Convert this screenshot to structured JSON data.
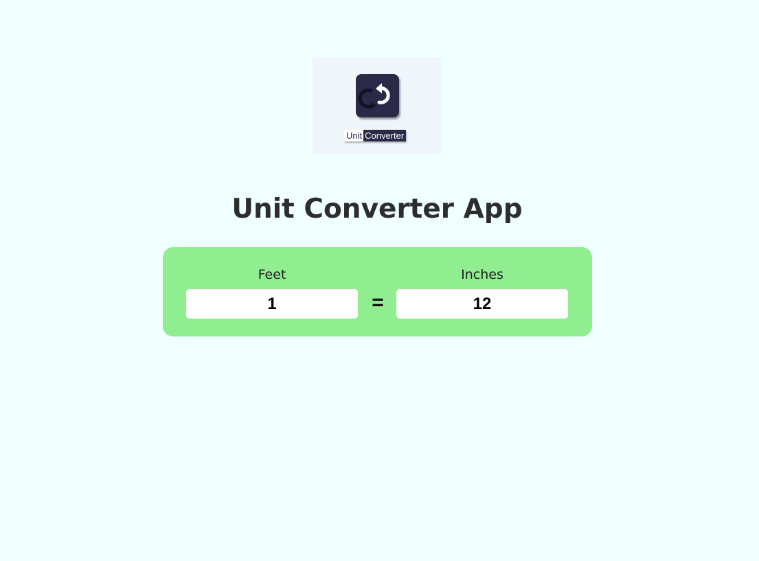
{
  "logo": {
    "icon": "unit-converter-arrows-icon",
    "word1": "Unit",
    "word2": "Converter"
  },
  "title": "Unit Converter App",
  "converter": {
    "from": {
      "label": "Feet",
      "value": "1"
    },
    "equals": "=",
    "to": {
      "label": "Inches",
      "value": "12"
    }
  },
  "colors": {
    "page_background": "#f0ffff",
    "panel_background": "#90ee90",
    "logo_dark": "#2b2948",
    "title_text": "#2d2d2d"
  }
}
